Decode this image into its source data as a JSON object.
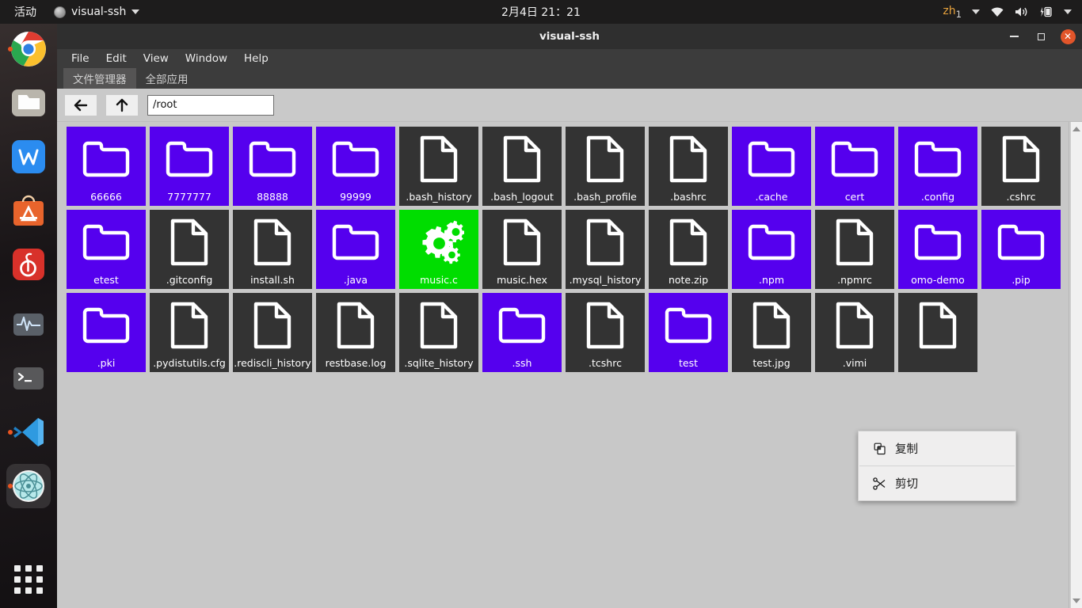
{
  "topbar": {
    "activities": "活动",
    "app_name": "visual-ssh",
    "app_icon": "app-circle-icon",
    "clock": "2月4日  21：21",
    "ime": "zh",
    "ime_sub": "1",
    "icons": [
      "wifi-icon",
      "volume-icon",
      "battery-icon",
      "chevron-down-icon"
    ]
  },
  "dock": {
    "items": [
      {
        "name": "google-chrome",
        "running": true
      },
      {
        "name": "files-manager",
        "running": false
      },
      {
        "name": "wps-office",
        "running": false
      },
      {
        "name": "ubuntu-software",
        "running": false
      },
      {
        "name": "netease-music",
        "running": false
      },
      {
        "name": "system-monitor",
        "running": false
      },
      {
        "name": "terminal",
        "running": false
      },
      {
        "name": "vscode",
        "running": true
      },
      {
        "name": "electron-app",
        "running": true
      }
    ],
    "show_apps": "show-applications"
  },
  "window": {
    "title": "visual-ssh",
    "buttons": {
      "minimize": "–",
      "maximize": "□",
      "close": "✕"
    },
    "menus": [
      "File",
      "Edit",
      "View",
      "Window",
      "Help"
    ],
    "tabs": [
      {
        "label": "文件管理器",
        "active": true
      },
      {
        "label": "全部应用",
        "active": false
      }
    ],
    "toolbar": {
      "back_label": "←",
      "up_label": "↑",
      "path_value": "/root"
    }
  },
  "files": [
    {
      "name": "66666",
      "type": "folder"
    },
    {
      "name": "7777777",
      "type": "folder"
    },
    {
      "name": "88888",
      "type": "folder"
    },
    {
      "name": "99999",
      "type": "folder"
    },
    {
      "name": ".bash_history",
      "type": "file"
    },
    {
      "name": ".bash_logout",
      "type": "file"
    },
    {
      "name": ".bash_profile",
      "type": "file"
    },
    {
      "name": ".bashrc",
      "type": "file"
    },
    {
      "name": ".cache",
      "type": "folder"
    },
    {
      "name": "cert",
      "type": "folder"
    },
    {
      "name": ".config",
      "type": "folder"
    },
    {
      "name": ".cshrc",
      "type": "file"
    },
    {
      "name": "etest",
      "type": "folder"
    },
    {
      "name": ".gitconfig",
      "type": "file"
    },
    {
      "name": "install.sh",
      "type": "file"
    },
    {
      "name": ".java",
      "type": "folder"
    },
    {
      "name": "music.c",
      "type": "code"
    },
    {
      "name": "music.hex",
      "type": "file"
    },
    {
      "name": ".mysql_history",
      "type": "file"
    },
    {
      "name": "note.zip",
      "type": "file"
    },
    {
      "name": ".npm",
      "type": "folder"
    },
    {
      "name": ".npmrc",
      "type": "file"
    },
    {
      "name": "omo-demo",
      "type": "folder"
    },
    {
      "name": ".pip",
      "type": "folder"
    },
    {
      "name": ".pki",
      "type": "folder"
    },
    {
      "name": ".pydistutils.cfg",
      "type": "file"
    },
    {
      "name": ".rediscli_history",
      "type": "file"
    },
    {
      "name": "restbase.log",
      "type": "file"
    },
    {
      "name": ".sqlite_history",
      "type": "file"
    },
    {
      "name": ".ssh",
      "type": "folder"
    },
    {
      "name": ".tcshrc",
      "type": "file"
    },
    {
      "name": "test",
      "type": "folder"
    },
    {
      "name": "test.jpg",
      "type": "file"
    },
    {
      "name": ".vimi",
      "type": "file"
    },
    {
      "name": "",
      "type": "file"
    }
  ],
  "context_menu": {
    "items": [
      {
        "label": "复制",
        "icon": "copy-icon"
      },
      {
        "label": "剪切",
        "icon": "scissors-icon"
      }
    ]
  },
  "colors": {
    "folder_bg": "#5500ee",
    "file_bg": "#333333",
    "code_bg": "#00dd00",
    "desktop_bg": "#c8c8c8",
    "accent_close": "#e2552a"
  }
}
